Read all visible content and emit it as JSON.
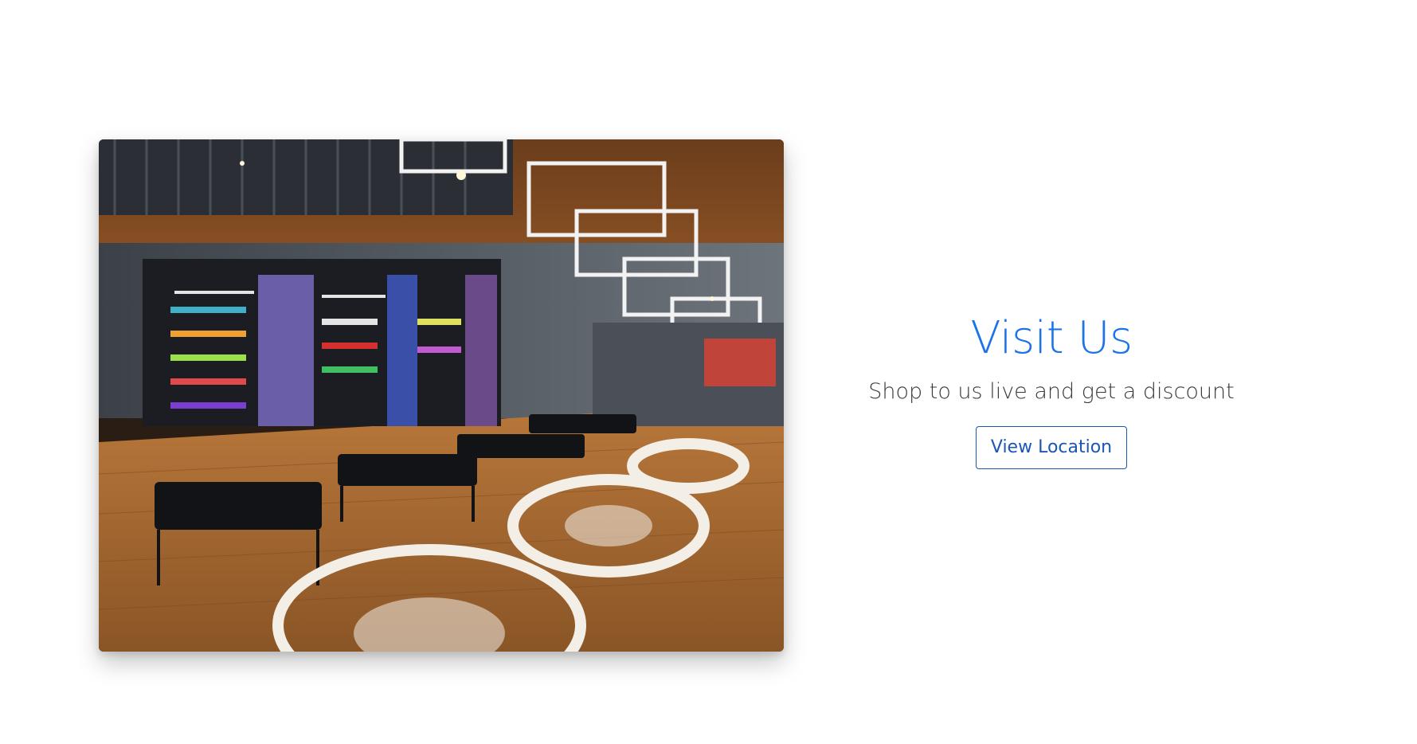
{
  "colors": {
    "accent": "#1a73e8",
    "button": "#1a56b3",
    "text": "#3a3a3a",
    "background": "#ffffff"
  },
  "media": {
    "icon": "store-interior-photo"
  },
  "visit": {
    "title": "Visit Us",
    "subtitle": "Shop to us live and get a discount",
    "button_label": "View Location"
  }
}
